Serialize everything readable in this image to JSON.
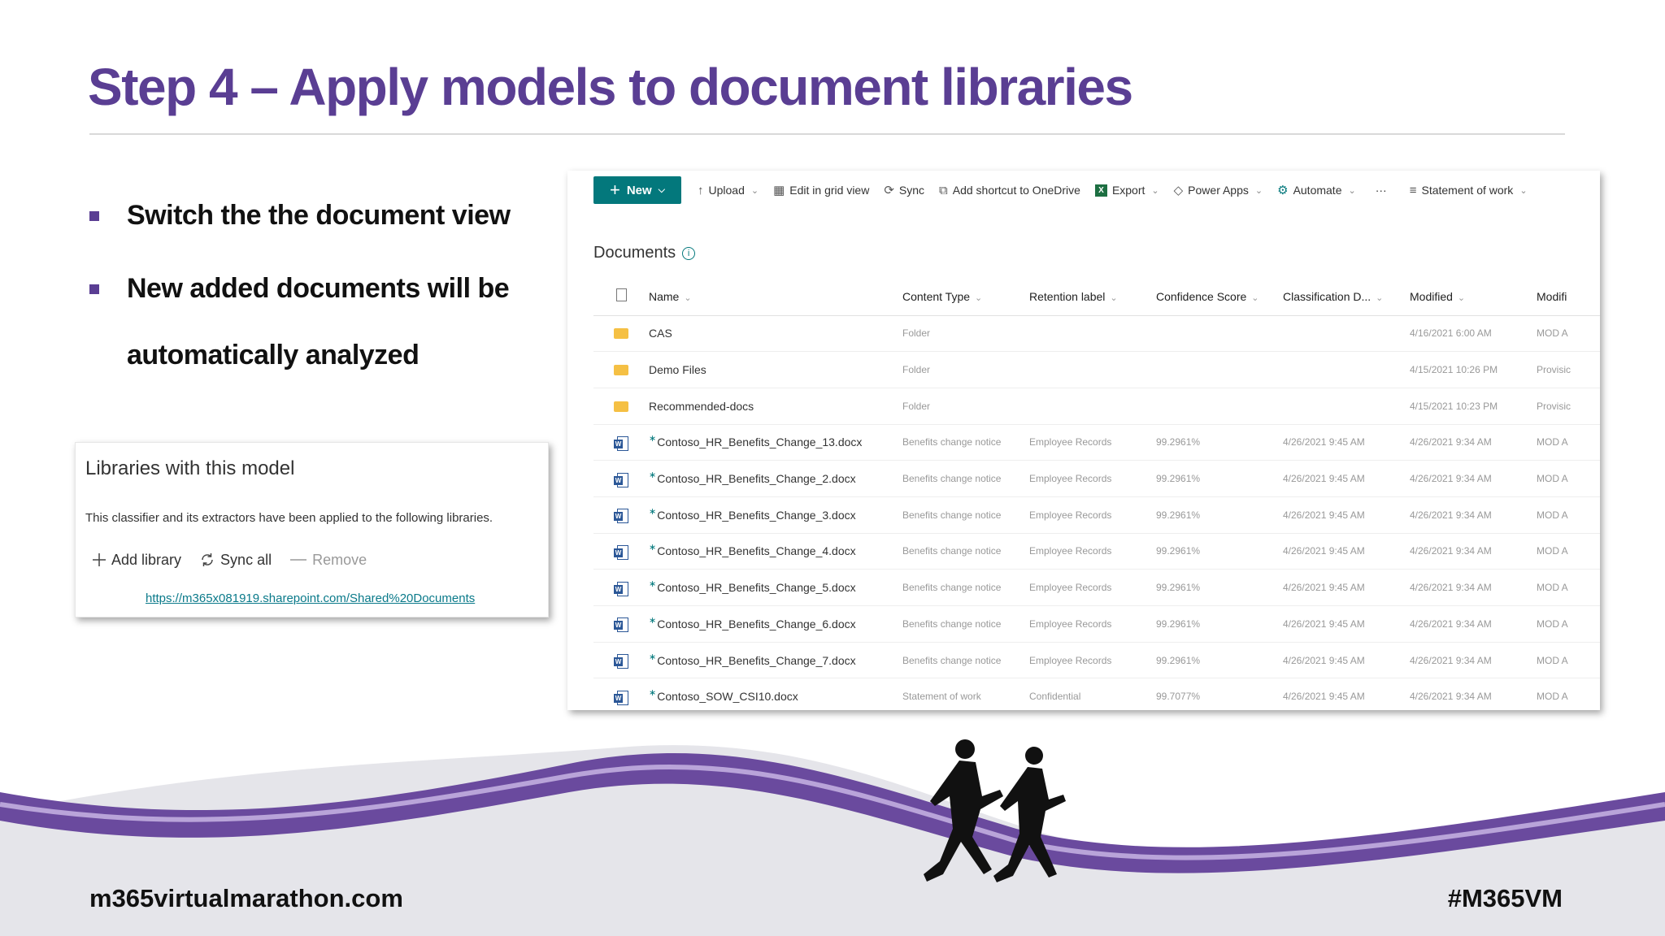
{
  "slide": {
    "title": "Step 4 – Apply models to document libraries",
    "bullets": [
      "Switch the the document view",
      "New added documents will be",
      "automatically analyzed"
    ],
    "footer_left": "m365virtualmarathon.com",
    "footer_right": "#M365VM",
    "accent_color": "#5a3e93"
  },
  "libraries_card": {
    "title": "Libraries with this model",
    "description": "This classifier and its extractors have been applied to the following libraries.",
    "add_library": "Add library",
    "sync_all": "Sync all",
    "remove": "Remove",
    "link": "https://m365x081919.sharepoint.com/Shared%20Documents"
  },
  "command_bar": {
    "new": "New",
    "upload": "Upload",
    "edit_grid": "Edit in grid view",
    "sync": "Sync",
    "add_shortcut": "Add shortcut to OneDrive",
    "export": "Export",
    "power_apps": "Power Apps",
    "automate": "Automate",
    "more": "···",
    "view": "Statement of work",
    "brand_color": "#03787c"
  },
  "documents": {
    "title": "Documents",
    "columns": [
      "Name",
      "Content Type",
      "Retention label",
      "Confidence Score",
      "Classification D...",
      "Modified",
      "Modifi"
    ],
    "rows": [
      {
        "type": "folder",
        "name": "CAS",
        "content_type": "Folder",
        "retention": "",
        "confidence": "",
        "classification": "",
        "modified": "4/16/2021 6:00 AM",
        "modified_by": "MOD A"
      },
      {
        "type": "folder",
        "name": "Demo Files",
        "content_type": "Folder",
        "retention": "",
        "confidence": "",
        "classification": "",
        "modified": "4/15/2021 10:26 PM",
        "modified_by": "Provisic"
      },
      {
        "type": "folder",
        "name": "Recommended-docs",
        "content_type": "Folder",
        "retention": "",
        "confidence": "",
        "classification": "",
        "modified": "4/15/2021 10:23 PM",
        "modified_by": "Provisic"
      },
      {
        "type": "word",
        "name": "Contoso_HR_Benefits_Change_13.docx",
        "content_type": "Benefits change notice",
        "retention": "Employee Records",
        "confidence": "99.2961%",
        "classification": "4/26/2021 9:45 AM",
        "modified": "4/26/2021 9:34 AM",
        "modified_by": "MOD A"
      },
      {
        "type": "word",
        "name": "Contoso_HR_Benefits_Change_2.docx",
        "content_type": "Benefits change notice",
        "retention": "Employee Records",
        "confidence": "99.2961%",
        "classification": "4/26/2021 9:45 AM",
        "modified": "4/26/2021 9:34 AM",
        "modified_by": "MOD A"
      },
      {
        "type": "word",
        "name": "Contoso_HR_Benefits_Change_3.docx",
        "content_type": "Benefits change notice",
        "retention": "Employee Records",
        "confidence": "99.2961%",
        "classification": "4/26/2021 9:45 AM",
        "modified": "4/26/2021 9:34 AM",
        "modified_by": "MOD A"
      },
      {
        "type": "word",
        "name": "Contoso_HR_Benefits_Change_4.docx",
        "content_type": "Benefits change notice",
        "retention": "Employee Records",
        "confidence": "99.2961%",
        "classification": "4/26/2021 9:45 AM",
        "modified": "4/26/2021 9:34 AM",
        "modified_by": "MOD A"
      },
      {
        "type": "word",
        "name": "Contoso_HR_Benefits_Change_5.docx",
        "content_type": "Benefits change notice",
        "retention": "Employee Records",
        "confidence": "99.2961%",
        "classification": "4/26/2021 9:45 AM",
        "modified": "4/26/2021 9:34 AM",
        "modified_by": "MOD A"
      },
      {
        "type": "word",
        "name": "Contoso_HR_Benefits_Change_6.docx",
        "content_type": "Benefits change notice",
        "retention": "Employee Records",
        "confidence": "99.2961%",
        "classification": "4/26/2021 9:45 AM",
        "modified": "4/26/2021 9:34 AM",
        "modified_by": "MOD A"
      },
      {
        "type": "word",
        "name": "Contoso_HR_Benefits_Change_7.docx",
        "content_type": "Benefits change notice",
        "retention": "Employee Records",
        "confidence": "99.2961%",
        "classification": "4/26/2021 9:45 AM",
        "modified": "4/26/2021 9:34 AM",
        "modified_by": "MOD A"
      },
      {
        "type": "word",
        "name": "Contoso_SOW_CSI10.docx",
        "content_type": "Statement of work",
        "retention": "Confidential",
        "confidence": "99.7077%",
        "classification": "4/26/2021 9:45 AM",
        "modified": "4/26/2021 9:34 AM",
        "modified_by": "MOD A"
      }
    ]
  }
}
